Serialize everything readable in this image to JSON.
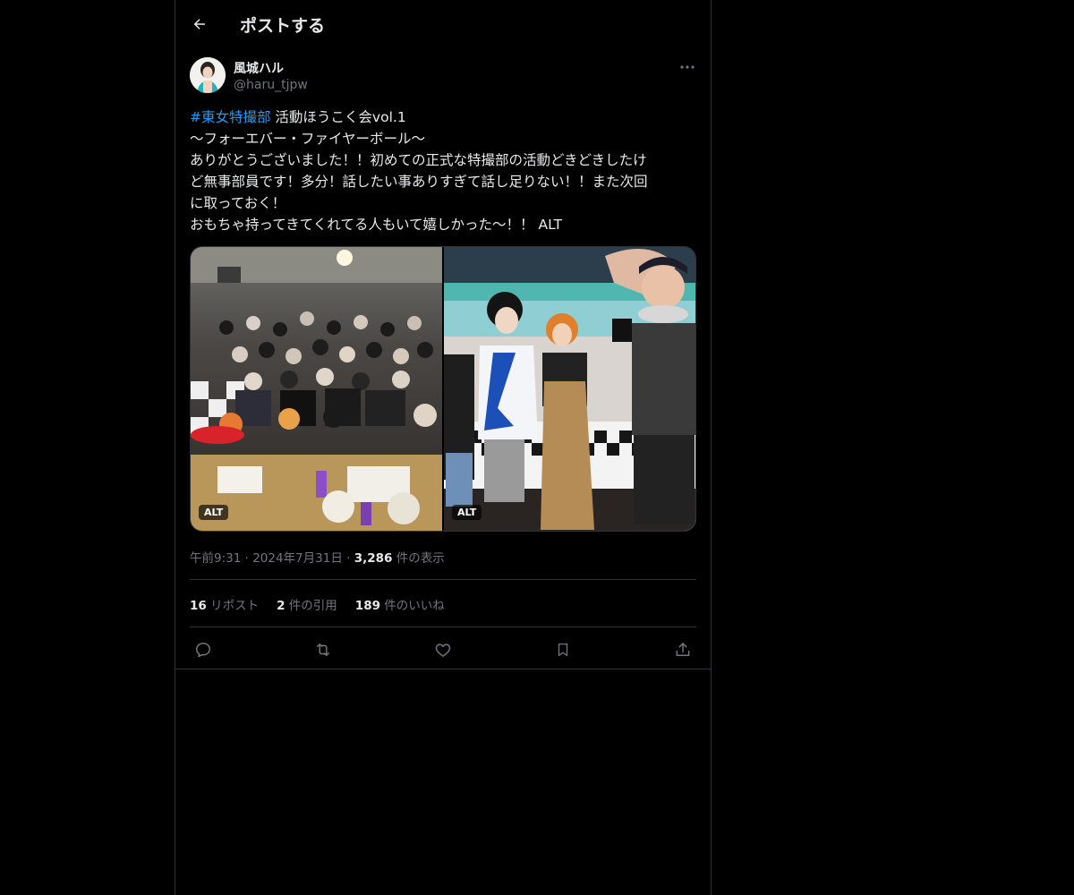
{
  "header": {
    "title": "ポストする",
    "back_icon": "back-arrow-icon"
  },
  "author": {
    "display_name": "風城ハル",
    "handle": "@haru_tjpw",
    "avatar_icon": "avatar-icon"
  },
  "tweet": {
    "hashtag": "#東女特撮部",
    "line1_rest": " 活動ほうこく会vol.1",
    "line2": "〜フォーエバー・ファイヤーボール〜",
    "line3": "ありがとうございました！！初めての正式な特撮部の活動どきどきしたけ",
    "line4": "ど無事部員です！多分！話したい事ありすぎて話し足りない！！また次回",
    "line5": "に取っておく！",
    "line6": "おもちゃ持ってきてくれてる人もいて嬉しかった〜！！ ALT"
  },
  "media": {
    "photos": [
      {
        "alt_label": "ALT",
        "description": "group-photo"
      },
      {
        "alt_label": "ALT",
        "description": "four-people-photo"
      }
    ]
  },
  "meta": {
    "time": "午前9:31",
    "sep1": " · ",
    "date": "2024年7月31日",
    "sep2": " · ",
    "views_count": "3,286",
    "views_label": " 件の表示"
  },
  "stats": {
    "reposts_count": "16",
    "reposts_label": " リポスト",
    "quotes_count": "2",
    "quotes_label": " 件の引用",
    "likes_count": "189",
    "likes_label": " 件のいいね"
  },
  "actions": [
    "reply-icon",
    "repost-icon",
    "like-icon",
    "bookmark-icon",
    "share-icon"
  ],
  "colors": {
    "background": "#000000",
    "text": "#e7e9ea",
    "muted": "#71767b",
    "accent": "#1d9bf0",
    "border": "#2f3336"
  }
}
